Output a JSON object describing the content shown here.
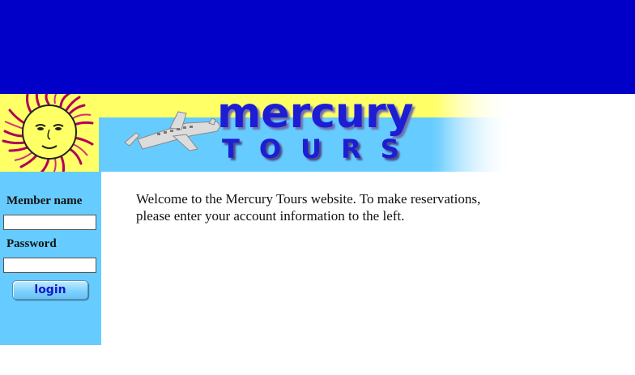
{
  "header": {
    "logo_word": "mercury",
    "logo_sub": "TOURS"
  },
  "login_form": {
    "member_name_label": "Member name",
    "member_name_value": "",
    "password_label": "Password",
    "password_value": "",
    "login_button": "login"
  },
  "main": {
    "welcome_text": "Welcome to the Mercury Tours website. To make reservations, please enter your account information to the left."
  },
  "colors": {
    "top_banner": "#0000c8",
    "sidebar": "#66ccff",
    "logo_text": "#1d1dd4",
    "header_yellow": "#ffff66"
  },
  "icons": {
    "sun": "sun-logo-icon",
    "plane": "airplane-icon"
  }
}
